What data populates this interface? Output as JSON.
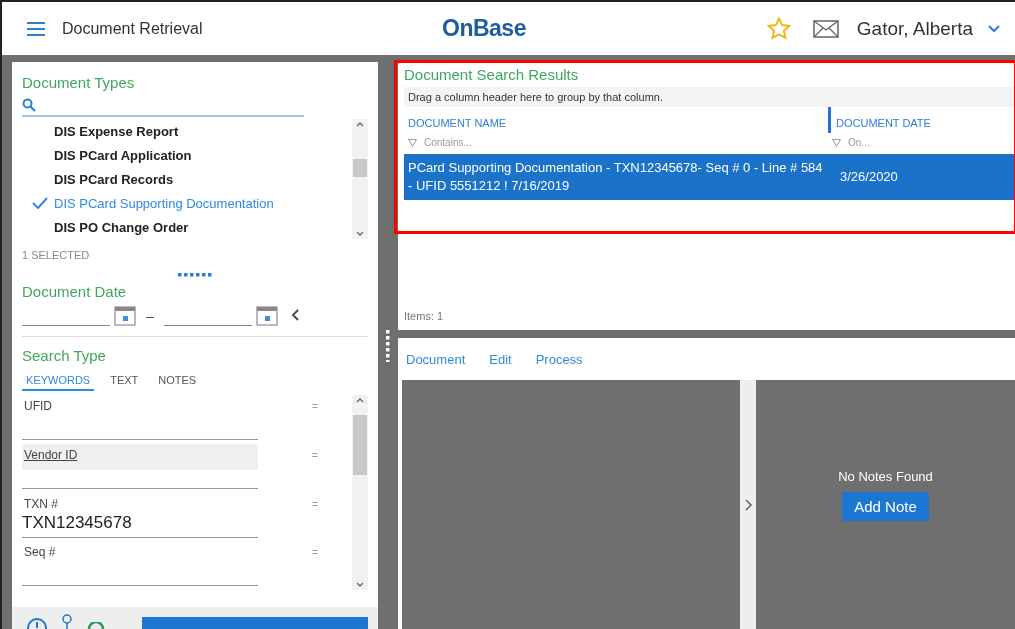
{
  "header": {
    "title": "Document Retrieval",
    "logo": "OnBase",
    "user": "Gator, Alberta"
  },
  "document_types": {
    "heading": "Document Types",
    "items": [
      {
        "label": "DIS Expense Report",
        "selected": false
      },
      {
        "label": "DIS PCard Application",
        "selected": false
      },
      {
        "label": "DIS PCard Records",
        "selected": false
      },
      {
        "label": "DIS PCard Supporting Documentation",
        "selected": true
      },
      {
        "label": "DIS PO Change Order",
        "selected": false
      }
    ],
    "count": "1 SELECTED"
  },
  "document_date": {
    "heading": "Document Date",
    "separator": "–"
  },
  "search_type": {
    "heading": "Search Type",
    "tabs": [
      {
        "label": "KEYWORDS",
        "selected": true
      },
      {
        "label": "TEXT",
        "selected": false
      },
      {
        "label": "NOTES",
        "selected": false
      }
    ],
    "keywords": [
      {
        "label": "UFID",
        "hovered": false,
        "operator": "="
      },
      {
        "label": "Vendor ID",
        "hovered": true,
        "operator": "="
      },
      {
        "label": "TXN #",
        "hovered": false,
        "operator": "=",
        "value": "TXN12345678"
      },
      {
        "label": "Seq #",
        "hovered": false,
        "operator": "="
      }
    ]
  },
  "results": {
    "heading": "Document Search Results",
    "group_hint": "Drag a column header here to group by that column.",
    "columns": [
      "DOCUMENT NAME",
      "DOCUMENT DATE"
    ],
    "filters": [
      {
        "placeholder": "Contains..."
      },
      {
        "placeholder": "On..."
      }
    ],
    "rows": [
      {
        "cells": [
          "PCard Supporting Documentation - TXN12345678- Seq # 0 - Line # 584 - UFID 5551212 ! 7/16/2019",
          "3/26/2020"
        ],
        "selected": true
      }
    ],
    "items_count": "Items: 1"
  },
  "viewer": {
    "menu": [
      "Document",
      "Edit",
      "Process"
    ],
    "notes_message": "No Notes Found",
    "add_note_button": "Add Note"
  }
}
